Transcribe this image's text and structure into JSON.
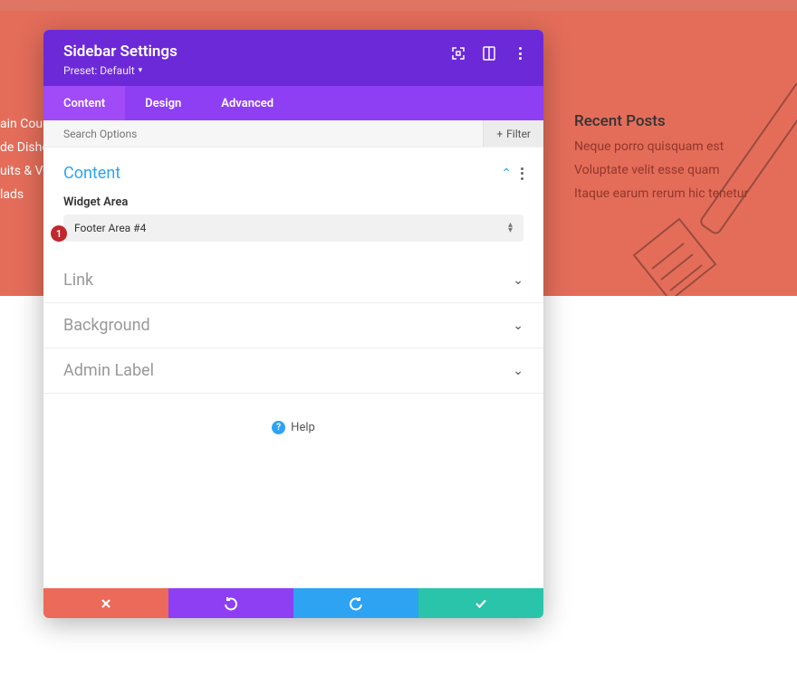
{
  "bg_menu": [
    "ain Cours",
    "de Dishes",
    "uits & Veg",
    "lads"
  ],
  "recent": {
    "title": "Recent Posts",
    "items": [
      "Neque porro quisquam est",
      "Voluptate velit esse quam",
      "Itaque earum rerum hic tenetur"
    ]
  },
  "panel": {
    "title": "Sidebar Settings",
    "preset": "Preset: Default"
  },
  "tabs": [
    "Content",
    "Design",
    "Advanced"
  ],
  "search": {
    "placeholder": "Search Options"
  },
  "filter_label": "Filter",
  "sections": {
    "content": {
      "title": "Content",
      "field_label": "Widget Area",
      "select_value": "Footer Area #4"
    },
    "link": {
      "title": "Link"
    },
    "background": {
      "title": "Background"
    },
    "admin_label": {
      "title": "Admin Label"
    }
  },
  "marker": "1",
  "help": "Help"
}
